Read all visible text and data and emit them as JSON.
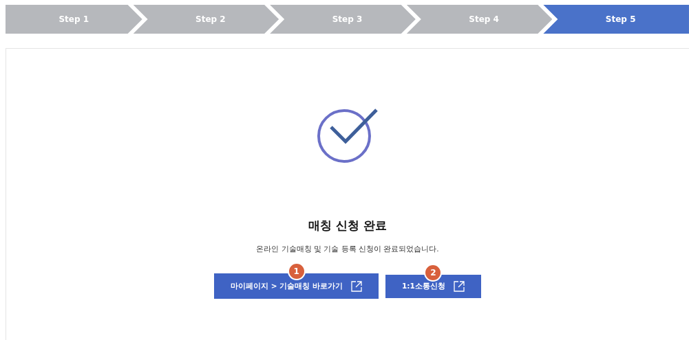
{
  "steps": [
    {
      "label": "Step 1",
      "selected": false
    },
    {
      "label": "Step 2",
      "selected": false
    },
    {
      "label": "Step 3",
      "selected": false
    },
    {
      "label": "Step 4",
      "selected": false
    },
    {
      "label": "Step 5",
      "selected": true
    }
  ],
  "result": {
    "title": "매칭 신청 완료",
    "message": "온라인 기술매칭 및 기술 등록 신청이 완료되었습니다."
  },
  "buttons": [
    {
      "label": "마이페이지 > 기술매칭 바로가기",
      "badge": "1"
    },
    {
      "label": "1:1소통신청",
      "badge": "2"
    }
  ]
}
